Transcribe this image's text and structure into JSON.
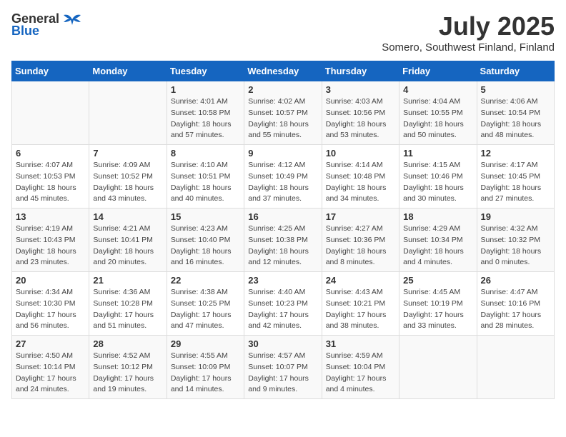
{
  "header": {
    "logo_general": "General",
    "logo_blue": "Blue",
    "title": "July 2025",
    "subtitle": "Somero, Southwest Finland, Finland"
  },
  "weekdays": [
    "Sunday",
    "Monday",
    "Tuesday",
    "Wednesday",
    "Thursday",
    "Friday",
    "Saturday"
  ],
  "weeks": [
    [
      {
        "day": "",
        "details": ""
      },
      {
        "day": "",
        "details": ""
      },
      {
        "day": "1",
        "details": "Sunrise: 4:01 AM\nSunset: 10:58 PM\nDaylight: 18 hours\nand 57 minutes."
      },
      {
        "day": "2",
        "details": "Sunrise: 4:02 AM\nSunset: 10:57 PM\nDaylight: 18 hours\nand 55 minutes."
      },
      {
        "day": "3",
        "details": "Sunrise: 4:03 AM\nSunset: 10:56 PM\nDaylight: 18 hours\nand 53 minutes."
      },
      {
        "day": "4",
        "details": "Sunrise: 4:04 AM\nSunset: 10:55 PM\nDaylight: 18 hours\nand 50 minutes."
      },
      {
        "day": "5",
        "details": "Sunrise: 4:06 AM\nSunset: 10:54 PM\nDaylight: 18 hours\nand 48 minutes."
      }
    ],
    [
      {
        "day": "6",
        "details": "Sunrise: 4:07 AM\nSunset: 10:53 PM\nDaylight: 18 hours\nand 45 minutes."
      },
      {
        "day": "7",
        "details": "Sunrise: 4:09 AM\nSunset: 10:52 PM\nDaylight: 18 hours\nand 43 minutes."
      },
      {
        "day": "8",
        "details": "Sunrise: 4:10 AM\nSunset: 10:51 PM\nDaylight: 18 hours\nand 40 minutes."
      },
      {
        "day": "9",
        "details": "Sunrise: 4:12 AM\nSunset: 10:49 PM\nDaylight: 18 hours\nand 37 minutes."
      },
      {
        "day": "10",
        "details": "Sunrise: 4:14 AM\nSunset: 10:48 PM\nDaylight: 18 hours\nand 34 minutes."
      },
      {
        "day": "11",
        "details": "Sunrise: 4:15 AM\nSunset: 10:46 PM\nDaylight: 18 hours\nand 30 minutes."
      },
      {
        "day": "12",
        "details": "Sunrise: 4:17 AM\nSunset: 10:45 PM\nDaylight: 18 hours\nand 27 minutes."
      }
    ],
    [
      {
        "day": "13",
        "details": "Sunrise: 4:19 AM\nSunset: 10:43 PM\nDaylight: 18 hours\nand 23 minutes."
      },
      {
        "day": "14",
        "details": "Sunrise: 4:21 AM\nSunset: 10:41 PM\nDaylight: 18 hours\nand 20 minutes."
      },
      {
        "day": "15",
        "details": "Sunrise: 4:23 AM\nSunset: 10:40 PM\nDaylight: 18 hours\nand 16 minutes."
      },
      {
        "day": "16",
        "details": "Sunrise: 4:25 AM\nSunset: 10:38 PM\nDaylight: 18 hours\nand 12 minutes."
      },
      {
        "day": "17",
        "details": "Sunrise: 4:27 AM\nSunset: 10:36 PM\nDaylight: 18 hours\nand 8 minutes."
      },
      {
        "day": "18",
        "details": "Sunrise: 4:29 AM\nSunset: 10:34 PM\nDaylight: 18 hours\nand 4 minutes."
      },
      {
        "day": "19",
        "details": "Sunrise: 4:32 AM\nSunset: 10:32 PM\nDaylight: 18 hours\nand 0 minutes."
      }
    ],
    [
      {
        "day": "20",
        "details": "Sunrise: 4:34 AM\nSunset: 10:30 PM\nDaylight: 17 hours\nand 56 minutes."
      },
      {
        "day": "21",
        "details": "Sunrise: 4:36 AM\nSunset: 10:28 PM\nDaylight: 17 hours\nand 51 minutes."
      },
      {
        "day": "22",
        "details": "Sunrise: 4:38 AM\nSunset: 10:25 PM\nDaylight: 17 hours\nand 47 minutes."
      },
      {
        "day": "23",
        "details": "Sunrise: 4:40 AM\nSunset: 10:23 PM\nDaylight: 17 hours\nand 42 minutes."
      },
      {
        "day": "24",
        "details": "Sunrise: 4:43 AM\nSunset: 10:21 PM\nDaylight: 17 hours\nand 38 minutes."
      },
      {
        "day": "25",
        "details": "Sunrise: 4:45 AM\nSunset: 10:19 PM\nDaylight: 17 hours\nand 33 minutes."
      },
      {
        "day": "26",
        "details": "Sunrise: 4:47 AM\nSunset: 10:16 PM\nDaylight: 17 hours\nand 28 minutes."
      }
    ],
    [
      {
        "day": "27",
        "details": "Sunrise: 4:50 AM\nSunset: 10:14 PM\nDaylight: 17 hours\nand 24 minutes."
      },
      {
        "day": "28",
        "details": "Sunrise: 4:52 AM\nSunset: 10:12 PM\nDaylight: 17 hours\nand 19 minutes."
      },
      {
        "day": "29",
        "details": "Sunrise: 4:55 AM\nSunset: 10:09 PM\nDaylight: 17 hours\nand 14 minutes."
      },
      {
        "day": "30",
        "details": "Sunrise: 4:57 AM\nSunset: 10:07 PM\nDaylight: 17 hours\nand 9 minutes."
      },
      {
        "day": "31",
        "details": "Sunrise: 4:59 AM\nSunset: 10:04 PM\nDaylight: 17 hours\nand 4 minutes."
      },
      {
        "day": "",
        "details": ""
      },
      {
        "day": "",
        "details": ""
      }
    ]
  ]
}
